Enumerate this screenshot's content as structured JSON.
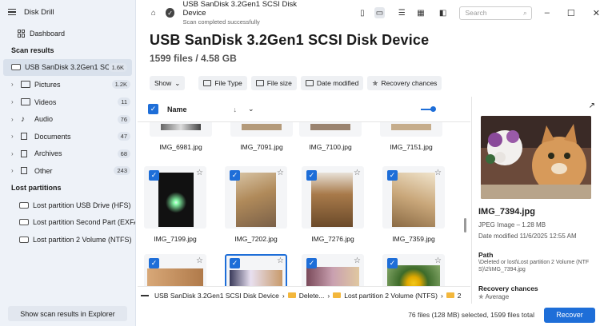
{
  "app": {
    "title": "Disk Drill"
  },
  "sidebar": {
    "dashboard": "Dashboard",
    "scan_results_title": "Scan results",
    "drive": {
      "label": "USB  SanDisk 3.2Gen1 SC...",
      "count": "1.6K"
    },
    "items": [
      {
        "label": "Pictures",
        "count": "1.2K",
        "icon": "picture-icon"
      },
      {
        "label": "Videos",
        "count": "11",
        "icon": "video-icon"
      },
      {
        "label": "Audio",
        "count": "76",
        "icon": "music-note-icon"
      },
      {
        "label": "Documents",
        "count": "47",
        "icon": "document-icon"
      },
      {
        "label": "Archives",
        "count": "68",
        "icon": "archive-icon"
      },
      {
        "label": "Other",
        "count": "243",
        "icon": "other-icon"
      }
    ],
    "lost_title": "Lost partitions",
    "lost": [
      {
        "label": "Lost partition USB Drive (HFS)"
      },
      {
        "label": "Lost partition Second Part (EXFAT)"
      },
      {
        "label": "Lost partition 2 Volume (NTFS)"
      }
    ],
    "explorer_button": "Show scan results in Explorer"
  },
  "topbar": {
    "device": "USB  SanDisk 3.2Gen1 SCSI Disk Device",
    "status": "Scan completed successfully",
    "search_placeholder": "Search"
  },
  "header": {
    "title": "USB  SanDisk 3.2Gen1 SCSI Disk Device",
    "subtitle": "1599 files / 4.58 GB"
  },
  "filters": {
    "show": "Show",
    "file_type": "File Type",
    "file_size": "File size",
    "date_modified": "Date modified",
    "recovery_chances": "Recovery chances"
  },
  "list": {
    "name_col": "Name"
  },
  "files_row0": [
    "IMG_6981.jpg",
    "IMG_7091.jpg",
    "IMG_7100.jpg",
    "IMG_7151.jpg"
  ],
  "files_row1": [
    "IMG_7199.jpg",
    "IMG_7202.jpg",
    "IMG_7276.jpg",
    "IMG_7359.jpg"
  ],
  "breadcrumb": {
    "drive": "USB  SanDisk 3.2Gen1 SCSI Disk Device",
    "folder1": "Delete...",
    "folder2": "Lost partition 2 Volume (NTFS)",
    "folder3": "2"
  },
  "footer": {
    "summary": "76 files (128 MB) selected, 1599 files total",
    "recover": "Recover"
  },
  "preview": {
    "name": "IMG_7394.jpg",
    "type": "JPEG Image – 1.28 MB",
    "date": "Date modified 11/6/2025 12:55 AM",
    "path_label": "Path",
    "path_value": "\\Deleted or lost\\Lost partition 2 Volume (NTFS)\\2\\IMG_7394.jpg",
    "recovery_label": "Recovery chances",
    "recovery_value": "Average"
  },
  "colors": {
    "accent": "#1e6ed8",
    "sidebar": "#eef2f8"
  }
}
